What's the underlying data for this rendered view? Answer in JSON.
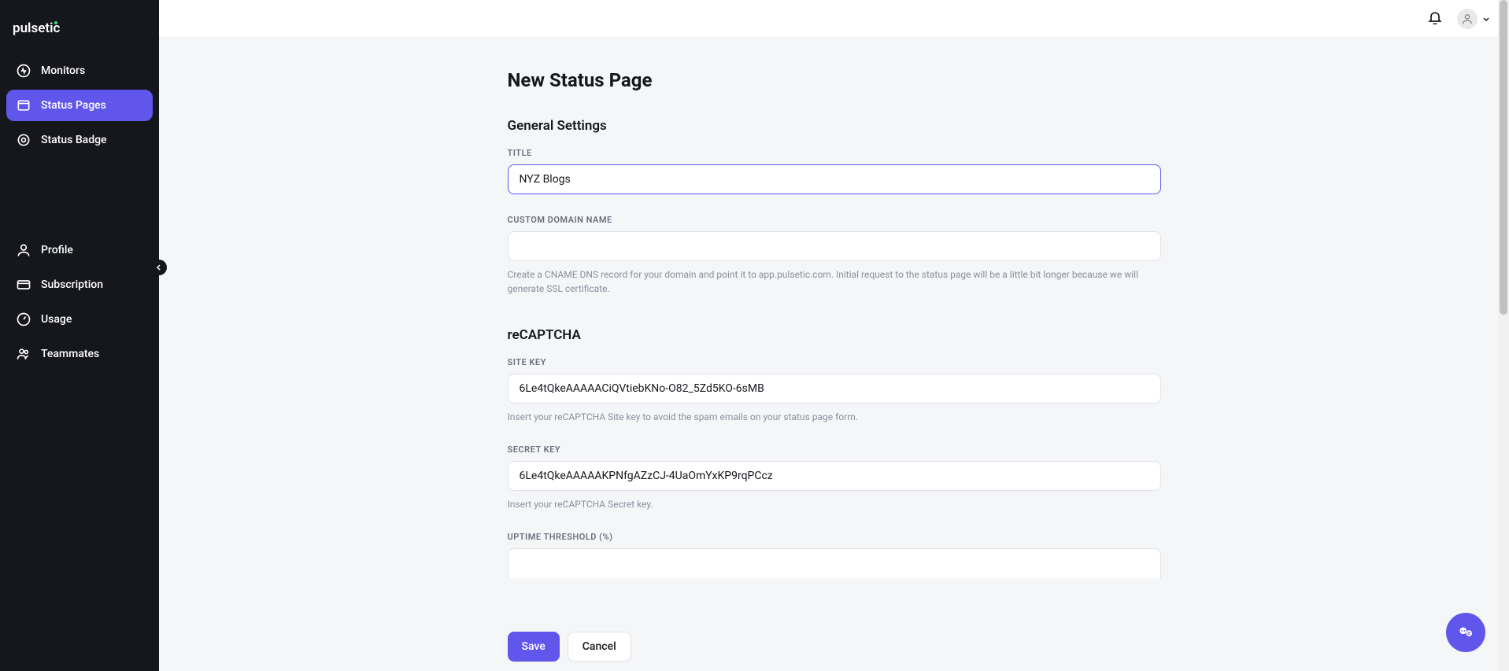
{
  "brand": "pulsetic",
  "sidebar": {
    "primary": [
      {
        "label": "Monitors",
        "icon": "monitor-pulse-icon"
      },
      {
        "label": "Status Pages",
        "icon": "window-icon",
        "active": true
      },
      {
        "label": "Status Badge",
        "icon": "badge-icon"
      }
    ],
    "secondary": [
      {
        "label": "Profile",
        "icon": "user-icon"
      },
      {
        "label": "Subscription",
        "icon": "card-icon"
      },
      {
        "label": "Usage",
        "icon": "gauge-icon"
      },
      {
        "label": "Teammates",
        "icon": "users-icon"
      }
    ]
  },
  "page": {
    "title": "New Status Page",
    "general": {
      "section_title": "General Settings",
      "title_label": "TITLE",
      "title_value": "NYZ Blogs",
      "custom_domain_label": "CUSTOM DOMAIN NAME",
      "custom_domain_value": "",
      "custom_domain_help": "Create a CNAME DNS record for your domain and point it to app.pulsetic.com. Initial request to the status page will be a little bit longer because we will generate SSL certificate."
    },
    "recaptcha": {
      "section_title": "reCAPTCHA",
      "site_key_label": "SITE KEY",
      "site_key_value": "6Le4tQkeAAAAACiQVtiebKNo-O82_5Zd5KO-6sMB",
      "site_key_help": "Insert your reCAPTCHA Site key to avoid the spam emails on your status page form.",
      "secret_key_label": "SECRET KEY",
      "secret_key_value": "6Le4tQkeAAAAAKPNfgAZzCJ-4UaOmYxKP9rqPCcz",
      "secret_key_help": "Insert your reCAPTCHA Secret key.",
      "uptime_threshold_label": "UPTIME THRESHOLD (%)"
    }
  },
  "footer": {
    "save_label": "Save",
    "cancel_label": "Cancel"
  }
}
